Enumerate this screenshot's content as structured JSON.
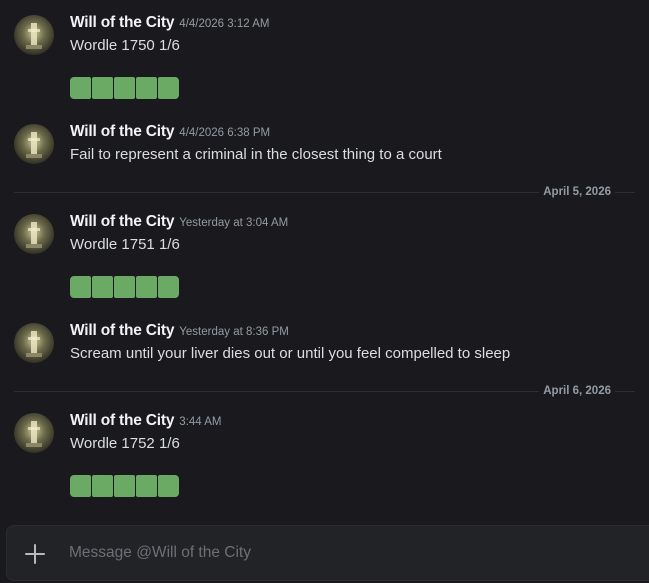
{
  "colors": {
    "background": "#1a1a1e",
    "wordle_green": "#6aaa64",
    "username": "#f2f3f5",
    "timestamp": "#949ba4",
    "message_text": "#dbdee1"
  },
  "messages": [
    {
      "username": "Will of the City",
      "timestamp": "4/4/2026 3:12 AM",
      "text": "Wordle 1750 1/6",
      "result_squares": [
        "green",
        "green",
        "green",
        "green",
        "green"
      ]
    },
    {
      "username": "Will of the City",
      "timestamp": "4/4/2026 6:38 PM",
      "text": "Fail to represent a criminal in the closest thing to a court"
    },
    {
      "username": "Will of the City",
      "timestamp": "Yesterday at 3:04 AM",
      "text": "Wordle 1751 1/6",
      "result_squares": [
        "green",
        "green",
        "green",
        "green",
        "green"
      ]
    },
    {
      "username": "Will of the City",
      "timestamp": "Yesterday at 8:36 PM",
      "text": "Scream until your liver dies out or until you feel compelled to sleep"
    },
    {
      "username": "Will of the City",
      "timestamp": "3:44 AM",
      "text": "Wordle 1752 1/6",
      "result_squares": [
        "green",
        "green",
        "green",
        "green",
        "green"
      ]
    }
  ],
  "date_dividers": [
    "April 5, 2026",
    "April 6, 2026"
  ],
  "composer": {
    "placeholder": "Message @Will of the City",
    "add_icon": "plus-icon"
  }
}
